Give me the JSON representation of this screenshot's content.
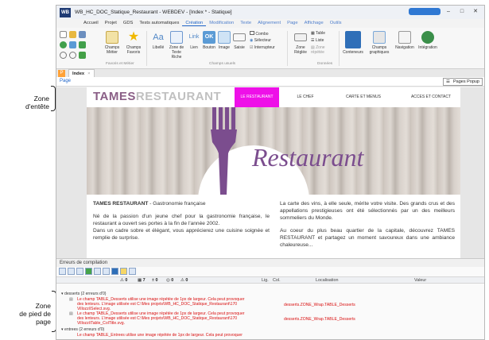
{
  "annotations": {
    "header_zone": [
      "Zone",
      "d'entête"
    ],
    "footer_zone": [
      "Zone",
      "de pied de",
      "page"
    ]
  },
  "window": {
    "logo": "WB",
    "title": "WB_HC_DOC_Statique_Restaurant - WEBDEV - [Index * - Statique]"
  },
  "menu": [
    "Accueil",
    "Projet",
    "GDS",
    "Tests automatiques",
    "Création",
    "Modification",
    "Texte",
    "Alignement",
    "Page",
    "Affichage",
    "Outils"
  ],
  "menu_active": "Création",
  "ribbon": {
    "champs_metier": "Champs Métier",
    "champs_favoris": "Champs Favoris",
    "libelle": "Libellé",
    "zone_texte_riche": "Zone de Texte Riche",
    "lien": "Lien",
    "bouton": "Bouton",
    "image": "Image",
    "saisie": "Saisie",
    "combo": "Combo",
    "selecteur": "Sélecteur",
    "interrupteur": "Interrupteur",
    "zone_reglee": "Zone Réglée",
    "table": "Table",
    "liste": "Liste",
    "zone_repetee": "Zone répétée",
    "conteneurs": "Conteneurs",
    "champs_graphiques": "Champs graphiques",
    "navigation": "Navigation",
    "integration": "Intégration",
    "group_favoris": "Favoris et Métier",
    "group_usuels": "Champs usuels",
    "group_donnees": "Données",
    "icon_aa": "Aa",
    "icon_link": "Link",
    "icon_ok": "OK"
  },
  "tabs": {
    "p_icon": "P",
    "index": "Index",
    "close": "×"
  },
  "pagebar": {
    "page_label": "Page",
    "popup_label": "Pages Popup"
  },
  "site": {
    "brand_part1": "TAMES",
    "brand_part2": "RESTAURANT",
    "nav": [
      "LE RESTAURANT",
      "LE CHEF",
      "CARTE ET MENUS",
      "ACCES ET CONTACT"
    ],
    "nav_active_index": 0,
    "hero_text": "Restaurant",
    "left_col": {
      "title_bold": "TAMES RESTAURANT",
      "title_rest": " - Gastronomie française",
      "p1": "Né de la passion d'un jeune chef pour la gastronomie française, le restaurant a ouvert ses portes à la fin de l'année 2002.",
      "p2": "Dans un cadre sobre et élégant, vous apprécierez une cuisine soignée et remplie de surprise."
    },
    "right_col": {
      "p1": "La carte des vins, à elle seule, mérite votre visite. Des grands crus et des appellations prestigieuses ont été sélectionnés par un des meilleurs sommeliers du Monde.",
      "p2": "Au coeur du plus beau quartier de la capitale, découvrez TAMES RESTAURANT et partagez un moment savoureux dans une ambiance chaleureuse..."
    }
  },
  "compile": {
    "title": "Erreurs de compilation",
    "filters": [
      "0",
      "7",
      "0",
      "0",
      "0"
    ],
    "columns": [
      "Lig.",
      "Col.",
      "Localisation",
      "Valeur"
    ],
    "groups": [
      {
        "label": "desserts (2 erreurs d'0)",
        "rows": [
          {
            "text": "Le champ TABLE_Desserts utilise une image répétée de 1px de largeur. Cela peut provoquer des lenteurs. L'image utilisée est C:\\Mes projets\\WB_HC_DOC_Statique_Restaurant\\170 Villozzi\\Select.svg.",
            "loc": "desserts.ZONE_Wrap.TABLE_Desserts"
          },
          {
            "text": "Le champ TABLE_Desserts utilise une image répétée de 1px de largeur. Cela peut provoquer des lenteurs. L'image utilisée est C:\\Mes projets\\WB_HC_DOC_Statique_Restaurant\\170 Villozzi\\Table_ColTitle.svg.",
            "loc": "desserts.ZONE_Wrap.TABLE_Desserts"
          }
        ]
      },
      {
        "label": "entrees (2 erreurs d'0)",
        "rows": [
          {
            "text": "Le champ TABLE_Entrees utilise une image répétée de 1px de largeur. Cela peut provoquer",
            "loc": ""
          }
        ]
      }
    ]
  },
  "colors": {
    "accent": "#1e64c8",
    "brand_purple": "#8a5e86",
    "nav_active": "#ee10e8",
    "error": "#d91010",
    "fork": "#7b4d8e"
  }
}
